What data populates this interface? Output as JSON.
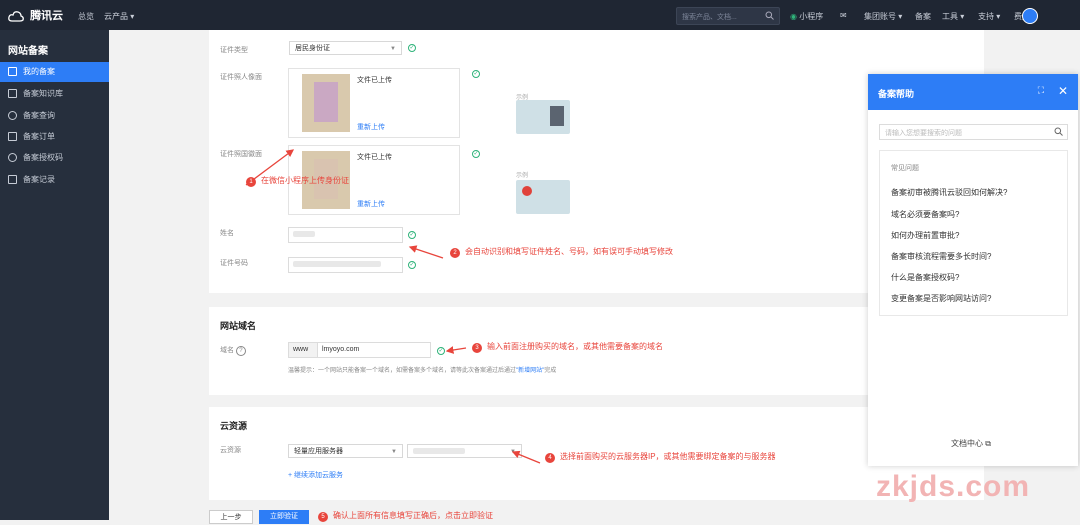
{
  "topbar": {
    "brand": "腾讯云",
    "nav_home": "总览",
    "nav_products": "云产品 ▾",
    "search_placeholder": "搜索产品、文档...",
    "miniprogram": "小程序",
    "account": "集团账号 ▾",
    "beian": "备案",
    "tools": "工具 ▾",
    "support": "支持 ▾",
    "billing": "费用 ▾"
  },
  "sidebar": {
    "title": "网站备案",
    "items": [
      {
        "label": "我的备案",
        "active": true
      },
      {
        "label": "备案知识库"
      },
      {
        "label": "备案查询"
      },
      {
        "label": "备案订单"
      },
      {
        "label": "备案授权码"
      },
      {
        "label": "备案记录"
      }
    ]
  },
  "id_section": {
    "cert_type_label": "证件类型",
    "cert_type_value": "居民身份证",
    "front_label": "证件照人像面",
    "back_label": "证件照国徽面",
    "uploaded": "文件已上传",
    "reupload": "重新上传",
    "example": "示例",
    "name_label": "姓名",
    "idno_label": "证件号码"
  },
  "domain_section": {
    "title": "网站域名",
    "label": "域名",
    "prefix": "www",
    "value": "lmyoyo.com",
    "tip_a": "温馨提示：一个网站只能备案一个域名，如需备案多个域名，请等此次备案通过后通过",
    "tip_link": "\"新增网站\"",
    "tip_b": "完成"
  },
  "cloud_section": {
    "title": "云资源",
    "label": "云资源",
    "type_value": "轻量应用服务器",
    "add_link": "+ 继续添加云服务"
  },
  "annotations": {
    "a1": "在微信小程序上传身份证",
    "a2": "会自动识别和填写证件姓名、号码，如有误可手动填写修改",
    "a3": "输入前面注册购买的域名，或其他需要备案的域名",
    "a4": "选择前面购买的云服务器IP，或其他需要绑定备案的与服务器",
    "a5": "确认上面所有信息填写正确后，点击立即验证"
  },
  "footer_buttons": {
    "prev": "上一步",
    "verify": "立即验证"
  },
  "help_panel": {
    "title": "备案帮助",
    "search_placeholder": "请输入您想要搜索的问题",
    "faq_heading": "常见问题",
    "questions": [
      "备案初审被腾讯云驳回如何解决?",
      "域名必须要备案吗?",
      "如何办理前置审批?",
      "备案审核流程需要多长时间?",
      "什么是备案授权码?",
      "变更备案是否影响网站访问?"
    ],
    "doc_center": "文档中心 ⧉"
  },
  "watermark": "zkjds.com",
  "colors": {
    "accent": "#2d7df6",
    "topbar": "#1f2633",
    "sidebar": "#262f3d",
    "annotation": "#e8453c",
    "success": "#2fb37a"
  }
}
